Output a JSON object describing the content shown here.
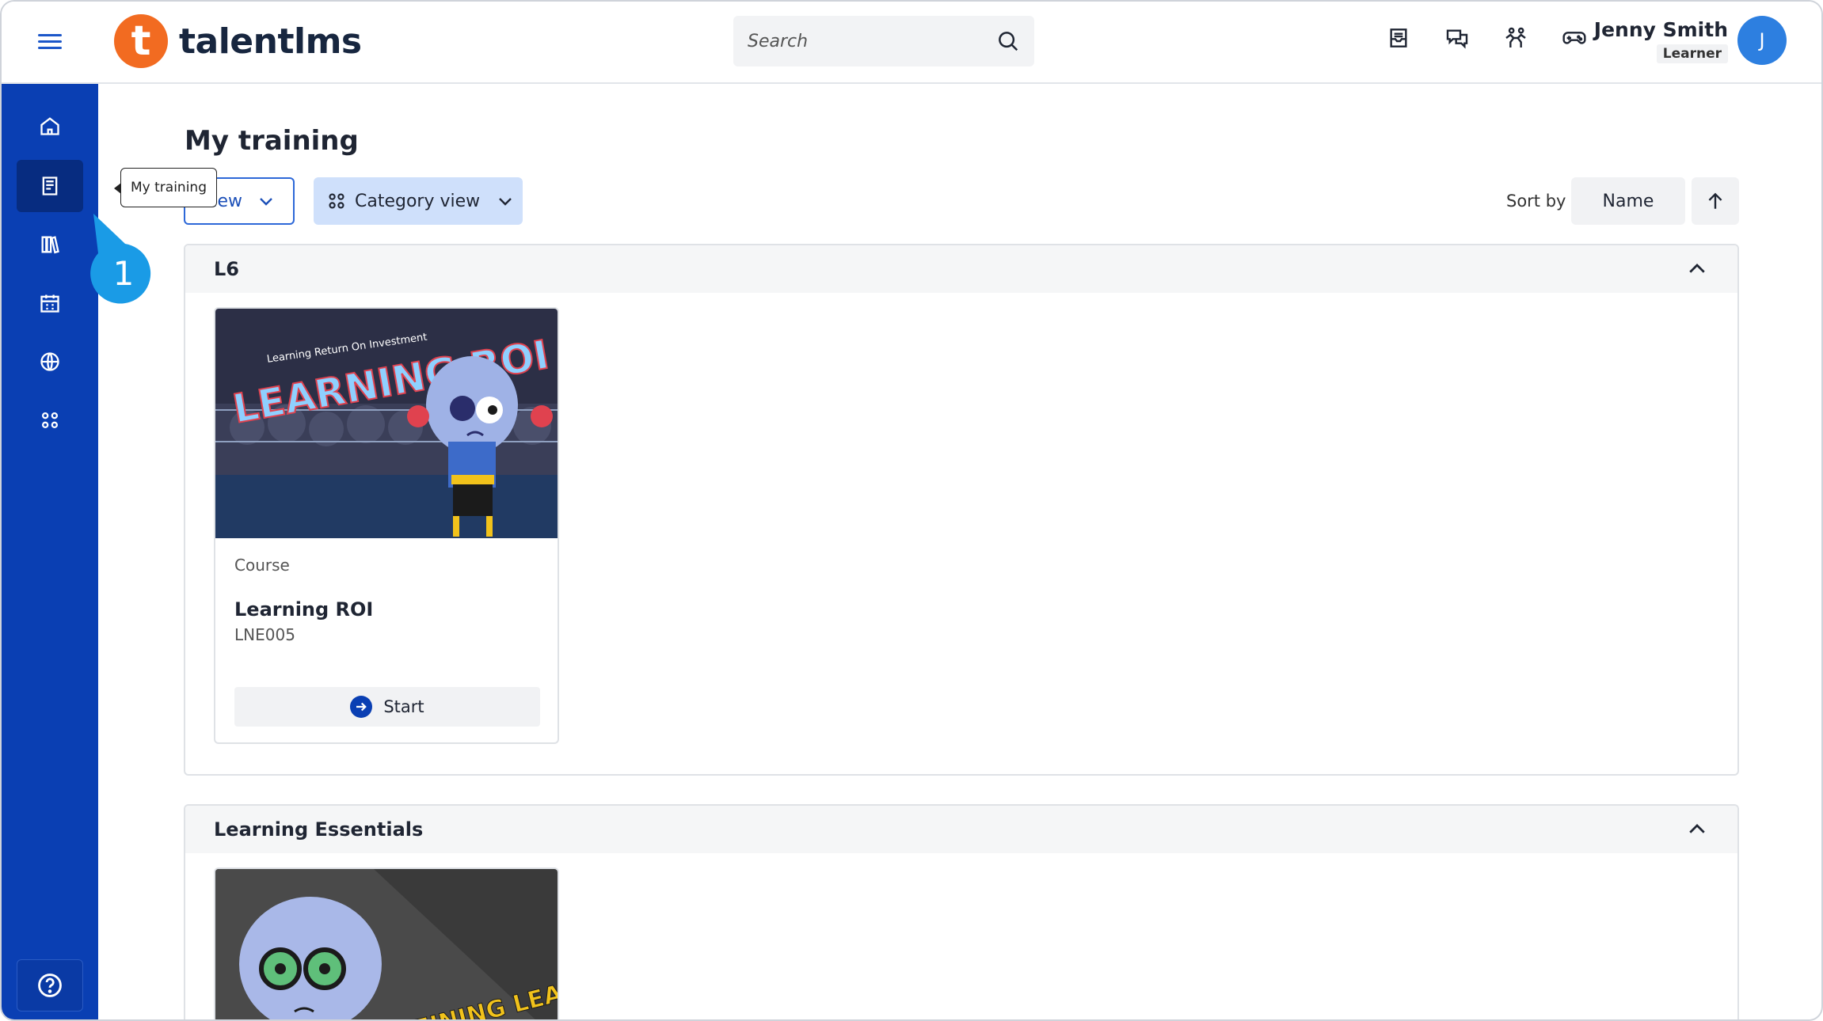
{
  "brand": {
    "name": "talentlms",
    "badge_letter": "t",
    "accent": "#f26b21",
    "primary": "#0a3fb3"
  },
  "search": {
    "placeholder": "Search"
  },
  "user": {
    "name": "Jenny Smith",
    "role": "Learner",
    "initial": "J"
  },
  "top_icons": [
    "inbox-icon",
    "chat-icon",
    "skills-icon",
    "gamepad-icon"
  ],
  "sidebar": {
    "items": [
      "home-icon",
      "my-training-icon",
      "catalog-icon",
      "calendar-icon",
      "globe-icon",
      "apps-icon"
    ],
    "active": "my-training-icon"
  },
  "tooltip": {
    "text": "My training"
  },
  "step_badge": {
    "number": "1"
  },
  "page": {
    "title": "My training",
    "view_button_label": "View",
    "category_view_label": "Category view",
    "sort_label": "Sort by",
    "sort_value": "Name"
  },
  "sections": [
    {
      "title": "L6",
      "cards": [
        {
          "type": "Course",
          "title": "Learning ROI",
          "code": "LNE005",
          "action": "Start",
          "image_caption_top": "Learning Return On Investment",
          "image_caption_main": "LEARNING ROI"
        }
      ]
    },
    {
      "title": "Learning Essentials",
      "cards": [
        {
          "image_caption_main": "DEFINING LEARNING OBJECTIVES"
        }
      ]
    }
  ]
}
